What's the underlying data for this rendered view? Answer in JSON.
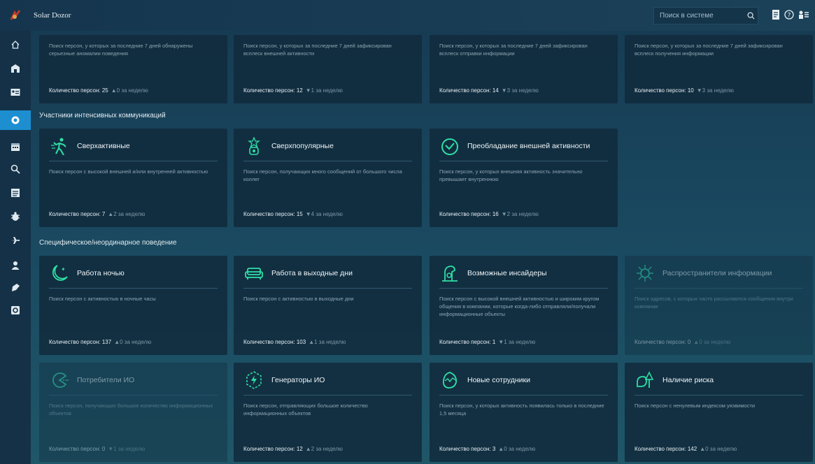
{
  "app": {
    "title": "Solar Dozor"
  },
  "search": {
    "placeholder": "Поиск в системе"
  },
  "footer_label": "Количество персон:",
  "sections": {
    "intensive": "Участники интенсивных коммуникаций",
    "specific": "Специфическое/неординарное поведение"
  },
  "top_cards": [
    {
      "desc": "Поиск персон, у которых за последние 7 дней обнаружены серьезные аномалии поведения",
      "count": "25",
      "delta": "▲0 за неделю"
    },
    {
      "desc": "Поиск персон, у которых за последние 7 дней зафиксирован всплеск внешней активности",
      "count": "12",
      "delta": "▼1 за неделю"
    },
    {
      "desc": "Поиск персон, у которых за последние 7 дней зафиксирован всплеск отправки информации",
      "count": "14",
      "delta": "▼3 за неделю"
    },
    {
      "desc": "Поиск персон, у которых за последние 7 дней зафиксирован всплеск получения информации",
      "count": "10",
      "delta": "▼3 за неделю"
    }
  ],
  "intensive_cards": [
    {
      "title": "Сверхактивные",
      "icon": "running-person-icon",
      "desc": "Поиск персон с высокой внешней и/или внутренней активностью",
      "count": "7",
      "delta": "▲2 за неделю"
    },
    {
      "title": "Сверхпопулярные",
      "icon": "star-person-icon",
      "desc": "Поиск персон, получающих много сообщений от большого числа коллег",
      "count": "15",
      "delta": "▼4 за неделю"
    },
    {
      "title": "Преобладание внешней активности",
      "icon": "check-circle-icon",
      "desc": "Поиск персон, у которых внешняя активность значительно превышает внутреннюю",
      "count": "16",
      "delta": "▼2 за неделю"
    }
  ],
  "specific_cards": [
    {
      "title": "Работа ночью",
      "icon": "moon-icon",
      "desc": "Поиск персон с активностью в ночные часы",
      "count": "137",
      "delta": "▲0 за неделю"
    },
    {
      "title": "Работа в выходные дни",
      "icon": "sofa-icon",
      "desc": "Поиск персон с активностью в выходные дни",
      "count": "103",
      "delta": "▲1 за неделю"
    },
    {
      "title": "Возможные инсайдеры",
      "icon": "insider-icon",
      "desc": "Поиск персон с высокой внешней активностью и широким кругом общения в компании, которые когда-либо отправляли/получали информационные объекты",
      "count": "1",
      "delta": "▼1 за неделю"
    },
    {
      "title": "Распространители информации",
      "icon": "virus-icon",
      "desc": "Поиск адресов, с которых часто рассылаются сообщения внутри компании",
      "count": "0",
      "delta": "▲0 за неделю"
    },
    {
      "title": "Потребители ИО",
      "icon": "pacman-icon",
      "desc": "Поиск персон, получающих большое количество информационных объектов",
      "count": "0",
      "delta": "▼1 за неделю"
    },
    {
      "title": "Генераторы ИО",
      "icon": "lightning-icon",
      "desc": "Поиск персон, отправляющих большое количество информационных объектов",
      "count": "12",
      "delta": "▲2 за неделю"
    },
    {
      "title": "Новые сотрудники",
      "icon": "egg-icon",
      "desc": "Поиск персон, у которых активность появилась только в последние 1,5 месяца",
      "count": "3",
      "delta": "▲0 за неделю"
    },
    {
      "title": "Наличие риска",
      "icon": "risk-icon",
      "desc": "Поиск персон с ненулевым индексом уязвимости",
      "count": "142",
      "delta": "▲0 за неделю"
    }
  ],
  "colors": {
    "accent": "#1d8fd1",
    "icon_green": "#2ee0a6",
    "card_bg": "#102a3c"
  }
}
